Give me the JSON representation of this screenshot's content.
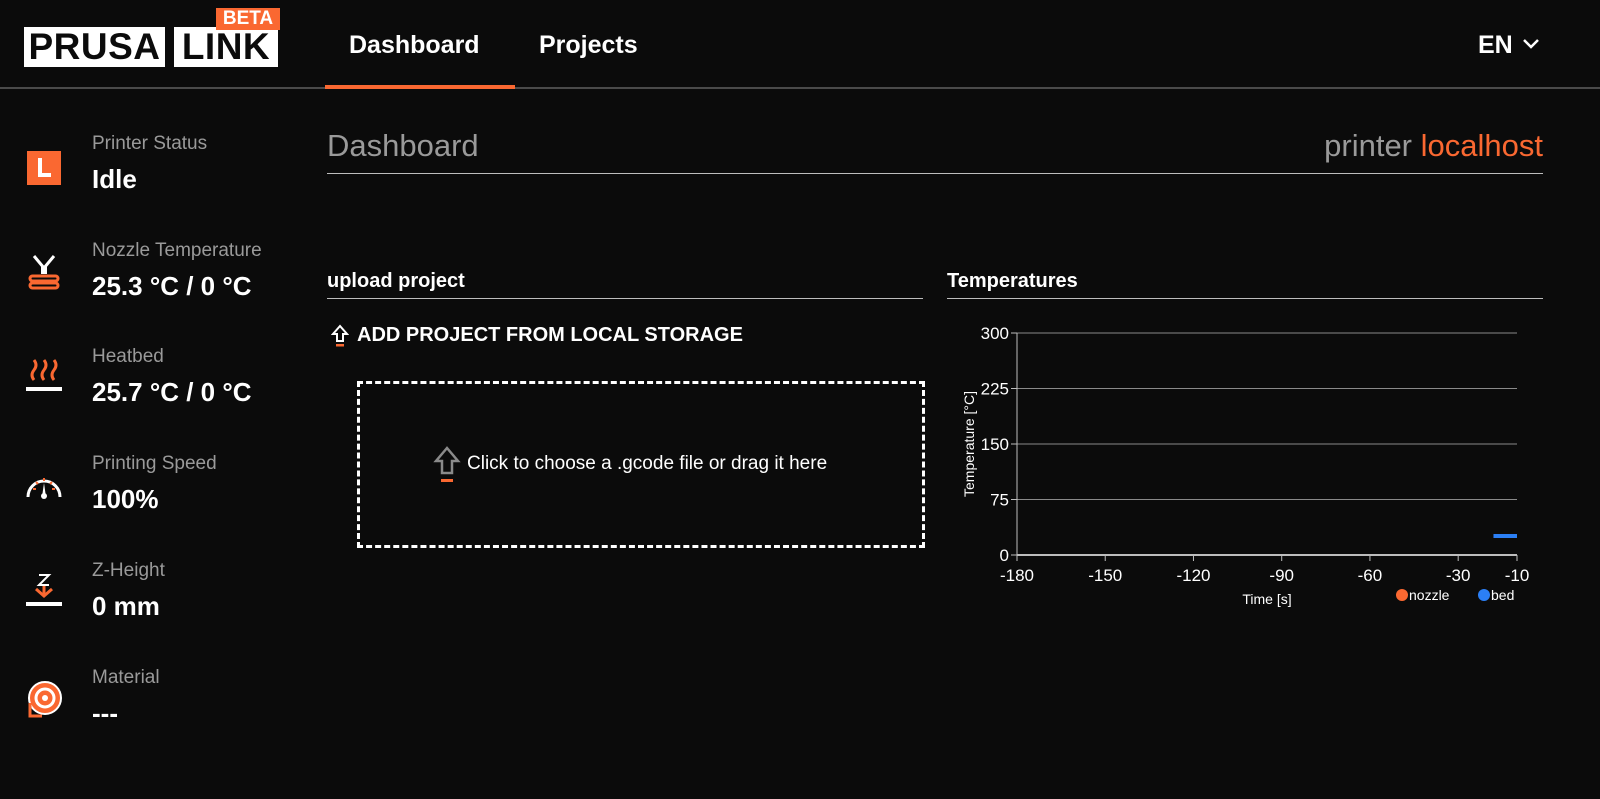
{
  "header": {
    "logo": {
      "prusa": "PRUSA",
      "link": "LINK",
      "beta": "BETA"
    },
    "nav": [
      {
        "label": "Dashboard",
        "active": true
      },
      {
        "label": "Projects",
        "active": false
      }
    ],
    "language": "EN"
  },
  "sidebar": {
    "items": [
      {
        "icon": "printer-status-icon",
        "label": "Printer Status",
        "value": "Idle"
      },
      {
        "icon": "nozzle-icon",
        "label": "Nozzle Temperature",
        "value": "25.3 °C / 0 °C"
      },
      {
        "icon": "heatbed-icon",
        "label": "Heatbed",
        "value": "25.7 °C / 0 °C"
      },
      {
        "icon": "speedometer-icon",
        "label": "Printing Speed",
        "value": "100%"
      },
      {
        "icon": "z-height-icon",
        "label": "Z-Height",
        "value": "0 mm"
      },
      {
        "icon": "spool-icon",
        "label": "Material",
        "value": "---"
      }
    ]
  },
  "main": {
    "title": "Dashboard",
    "printer_prefix": "printer",
    "printer_host": "localhost",
    "upload": {
      "title": "upload project",
      "add_local": "ADD PROJECT FROM LOCAL STORAGE",
      "dropzone_text": "Click to choose a .gcode file or drag it here"
    },
    "temperatures_title": "Temperatures"
  },
  "colors": {
    "accent": "#fa6831",
    "bed": "#2b7ff5",
    "background": "#0b0b0b"
  },
  "chart_data": {
    "type": "line",
    "xlabel": "Time [s]",
    "ylabel": "Temperature [°C]",
    "xlim": [
      -180,
      -10
    ],
    "ylim": [
      0,
      300
    ],
    "x_ticks": [
      "-180",
      "-150",
      "-120",
      "-90",
      "-60",
      "-30",
      "-10"
    ],
    "y_ticks": [
      "300",
      "225",
      "150",
      "75",
      "0"
    ],
    "legend_position": "bottom-right",
    "grid": true,
    "series": [
      {
        "name": "nozzle",
        "color": "#fa6831",
        "x": [],
        "y": []
      },
      {
        "name": "bed",
        "color": "#2b7ff5",
        "x": [
          -18,
          -10
        ],
        "y": [
          25.7,
          25.7
        ]
      }
    ]
  }
}
